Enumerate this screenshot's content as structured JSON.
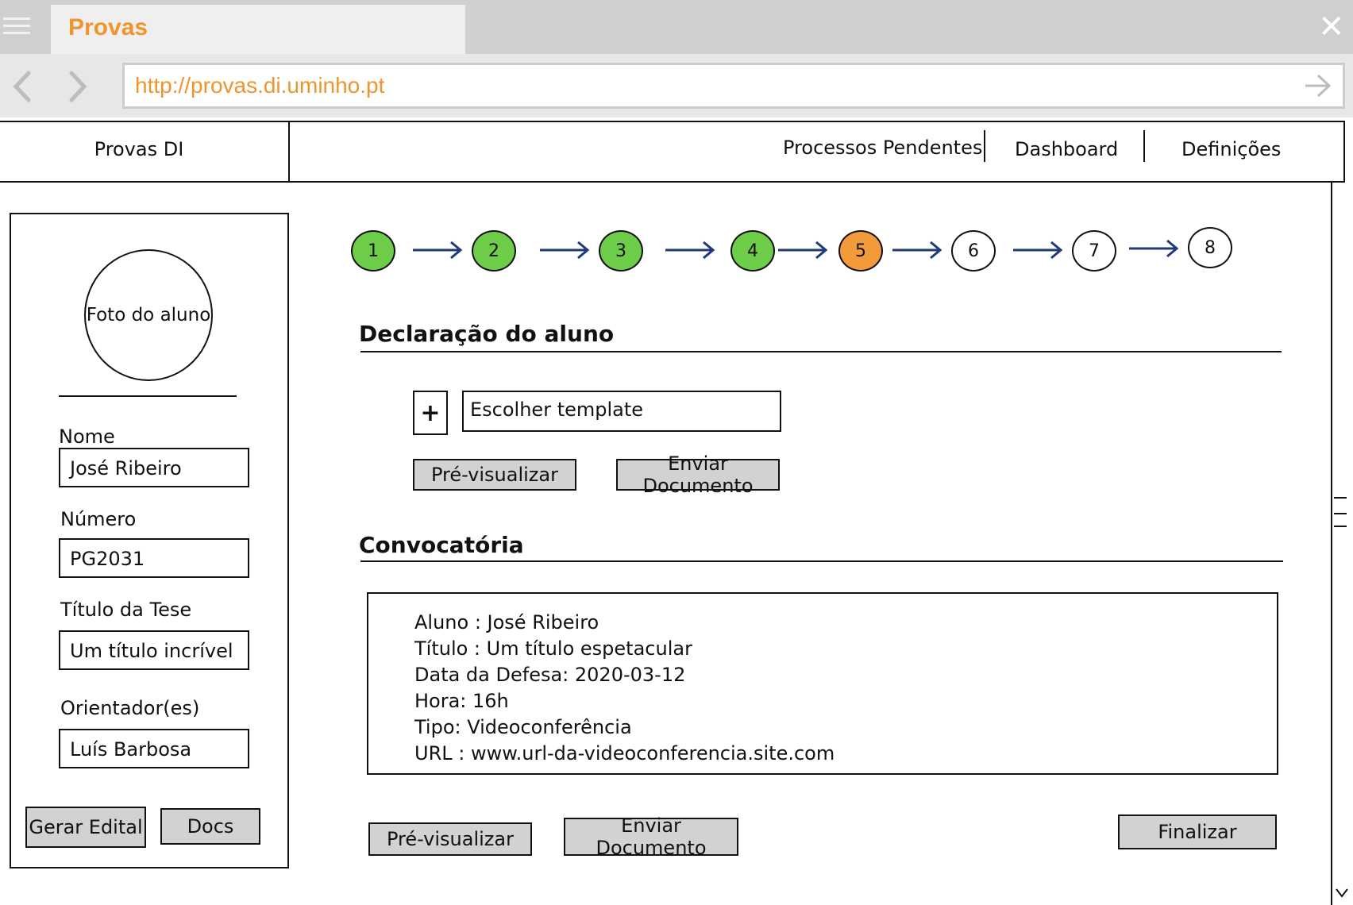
{
  "browser": {
    "tab_title": "Provas",
    "url": "http://provas.di.uminho.pt"
  },
  "header": {
    "brand": "Provas DI",
    "nav": [
      "Processos Pendentes",
      "Dashboard",
      "Definições"
    ]
  },
  "student": {
    "photo_label": "Foto do aluno",
    "fields": [
      {
        "label": "Nome",
        "value": "José Ribeiro"
      },
      {
        "label": "Número",
        "value": "PG2031"
      },
      {
        "label": "Título da Tese",
        "value": "Um título incrível"
      },
      {
        "label": "Orientador(es)",
        "value": "Luís Barbosa"
      }
    ],
    "buttons": [
      "Gerar Edital",
      "Docs"
    ]
  },
  "stepper": {
    "steps": [
      "1",
      "2",
      "3",
      "4",
      "5",
      "6",
      "7",
      "8"
    ],
    "status": [
      "done",
      "done",
      "done",
      "done",
      "current",
      "todo",
      "todo",
      "todo"
    ]
  },
  "declaration": {
    "title": "Declaração do aluno",
    "add_symbol": "+",
    "template_select": "Escolher template",
    "preview_button": "Pré-visualizar",
    "send_button": "Enviar Documento"
  },
  "convocatoria": {
    "title": "Convocatória",
    "lines": [
      "Aluno : José Ribeiro",
      "Título : Um título espetacular",
      "Data da Defesa: 2020-03-12",
      "Hora: 16h",
      "Tipo: Videoconferência",
      "URL : www.url-da-videoconferencia.site.com"
    ],
    "preview_button": "Pré-visualizar",
    "send_button": "Enviar Documento",
    "finish_button": "Finalizar"
  },
  "icons": {
    "menu": "hamburger-menu-icon",
    "close": "close-icon",
    "back": "chevron-left-icon",
    "forward": "chevron-right-icon",
    "go": "arrow-right-icon",
    "scroll_down": "chevron-down-icon",
    "step_arrow": "arrow-right-icon"
  },
  "colors": {
    "brand_orange": "#f0952c",
    "step_done": "#6dcc48",
    "step_current": "#f39a3a",
    "step_todo": "#ffffff",
    "arrow": "#1f3a7a",
    "button_gray": "#d2d2d2"
  }
}
